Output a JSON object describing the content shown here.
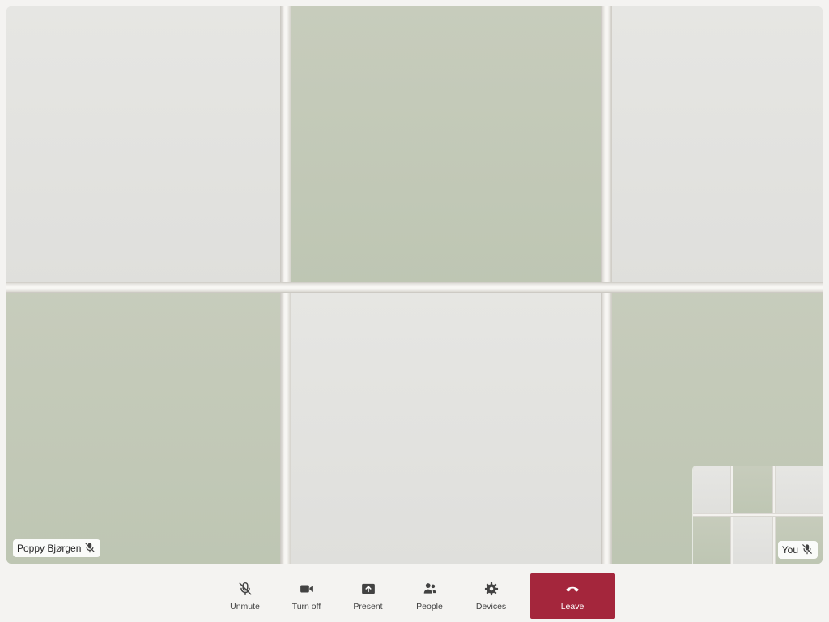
{
  "main_video": {
    "participant_name": "Poppy Bjørgen",
    "participant_mic_icon": "mic-off-icon"
  },
  "self_view": {
    "label": "You",
    "mic_icon": "mic-off-icon"
  },
  "toolbar": {
    "controls": [
      {
        "label": "Unmute",
        "icon": "mic-off-icon"
      },
      {
        "label": "Turn off",
        "icon": "video-camera-icon"
      },
      {
        "label": "Present",
        "icon": "present-screen-icon"
      },
      {
        "label": "People",
        "icon": "people-icon"
      },
      {
        "label": "Devices",
        "icon": "gear-icon"
      },
      {
        "label": "Leave",
        "icon": "hang-up-icon"
      }
    ]
  },
  "colors": {
    "leave_background": "#a4263c",
    "toolbar_background": "#f4f3f1",
    "label_text": "#242424",
    "tile_green": "#c2c8b6",
    "tile_white": "#e3e3e0"
  }
}
